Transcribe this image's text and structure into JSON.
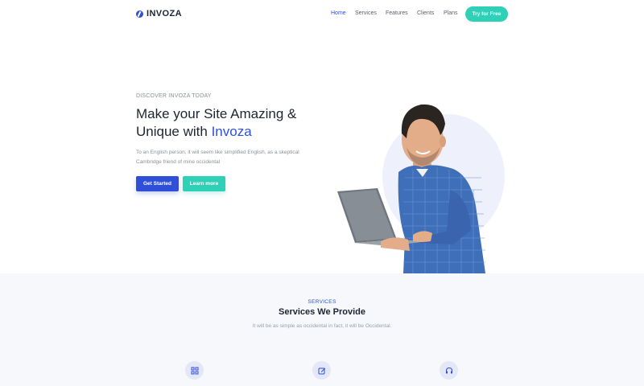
{
  "brand": {
    "name": "INVOZA",
    "logo_icon": "invoza-logo-icon"
  },
  "nav": {
    "links": [
      "Home",
      "Services",
      "Features",
      "Clients",
      "Plans"
    ],
    "active": "Home",
    "cta_label": "Try for Free"
  },
  "hero": {
    "eyebrow": "DISCOVER INVOZA TODAY",
    "title_line1": "Make your Site Amazing &",
    "title_line2_prefix": "Unique with ",
    "title_accent": "Invoza",
    "description": "To an English person, it will seem like simplified English, as a skeptical Cambridge friend of mine occidental",
    "primary_button": "Get Started",
    "secondary_button": "Learn more",
    "image": "man-with-laptop-photo"
  },
  "services": {
    "eyebrow": "SERVICES",
    "title": "Services We Provide",
    "description": "It will be as simple as occidental in fact, it will be Occidental.",
    "icons": [
      "grid-icon",
      "edit-icon",
      "headphones-icon"
    ]
  },
  "colors": {
    "primary": "#2f4fd8",
    "accent": "#2ed1b6",
    "text_dark": "#1f2430",
    "text_muted": "#8a8f99",
    "section_bg": "#f6f8fc"
  }
}
